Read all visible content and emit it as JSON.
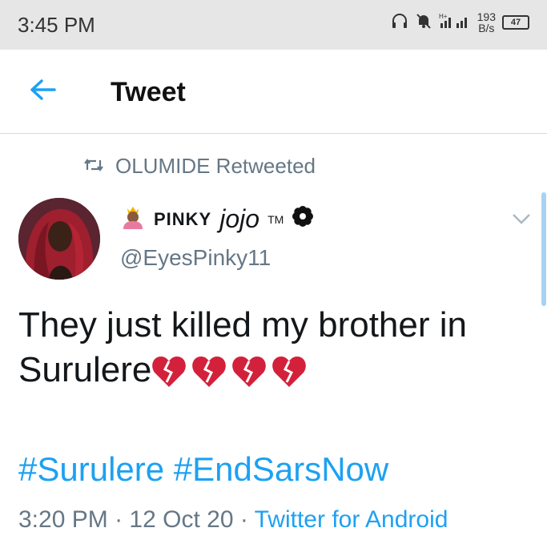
{
  "status_bar": {
    "time": "3:45 PM",
    "speed_value": "193",
    "speed_unit": "B/s",
    "battery": "47"
  },
  "header": {
    "title": "Tweet"
  },
  "tweet": {
    "retweeted_by": "OLUMIDE Retweeted",
    "name_caps": "PINKY",
    "name_italic": "jojo",
    "name_tm": "TM",
    "handle": "@EyesPinky11",
    "text": "They just killed my brother in Surulere",
    "emoji_count": 4,
    "hashtags": [
      "#Surulere",
      "#EndSarsNow"
    ],
    "time": "3:20 PM",
    "date": "12 Oct 20",
    "source": "Twitter for Android"
  },
  "colors": {
    "accent": "#1da1f2",
    "secondary_text": "#657786",
    "heart": "#d3213b"
  }
}
